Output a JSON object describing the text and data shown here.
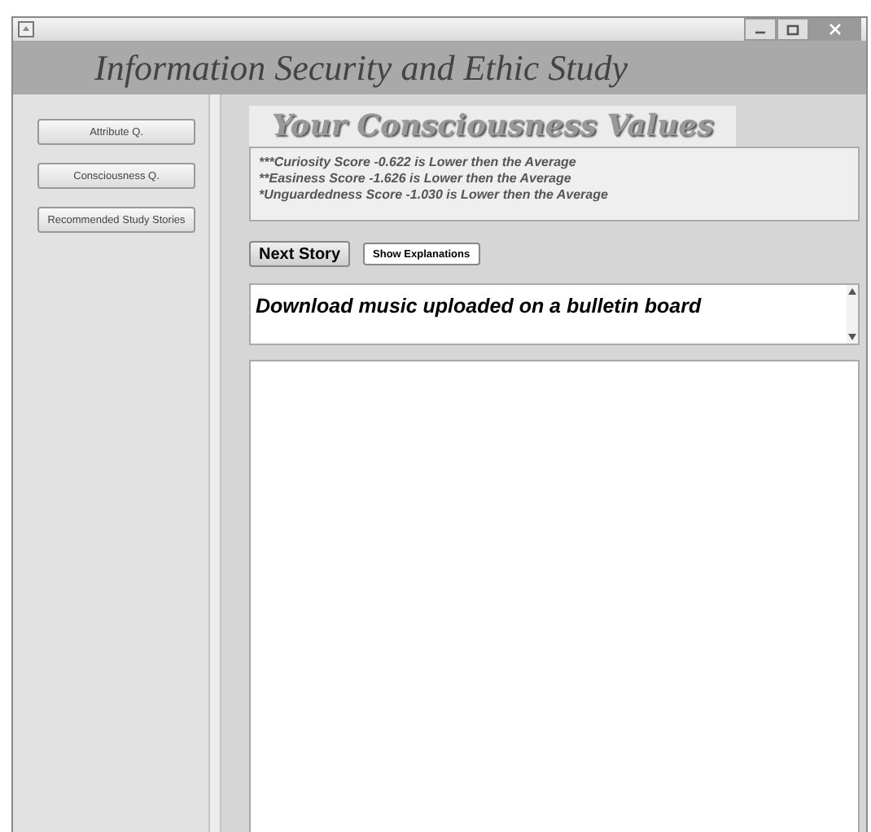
{
  "window": {
    "controls": [
      {
        "kind": "minimize"
      },
      {
        "kind": "maximize"
      },
      {
        "kind": "close"
      }
    ]
  },
  "header": {
    "title": "Information Security and Ethic Study"
  },
  "sidebar": {
    "buttons": [
      "Attribute Q.",
      "Consciousness Q.",
      "Recommended Study Stories"
    ]
  },
  "heading": "Your Consciousness Values",
  "scores": [
    "***Curiosity Score -0.622 is Lower then the Average",
    "**Easiness Score -1.626 is Lower then the Average",
    "*Unguardedness Score -1.030 is Lower then the Average"
  ],
  "actions": [
    "Next Story",
    "Show Explanations"
  ],
  "story": {
    "text": "Download music uploaded on a bulletin board"
  }
}
